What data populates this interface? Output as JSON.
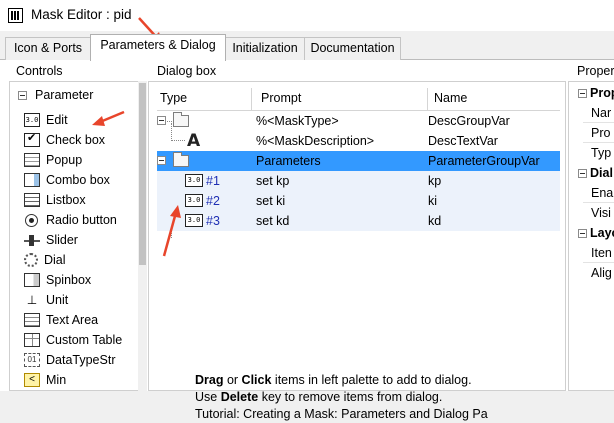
{
  "window": {
    "title": "Mask Editor : pid"
  },
  "tabs": [
    {
      "label": "Icon & Ports"
    },
    {
      "label": "Parameters & Dialog"
    },
    {
      "label": "Initialization"
    },
    {
      "label": "Documentation"
    }
  ],
  "controls": {
    "title": "Controls",
    "group_label": "Parameter",
    "items": [
      {
        "label": "Edit",
        "icon": "edit-icon",
        "glyph": "3.0"
      },
      {
        "label": "Check box",
        "icon": "checkbox-icon"
      },
      {
        "label": "Popup",
        "icon": "popup-icon"
      },
      {
        "label": "Combo box",
        "icon": "combo-box-icon"
      },
      {
        "label": "Listbox",
        "icon": "listbox-icon"
      },
      {
        "label": "Radio button",
        "icon": "radio-button-icon"
      },
      {
        "label": "Slider",
        "icon": "slider-icon"
      },
      {
        "label": "Dial",
        "icon": "dial-icon"
      },
      {
        "label": "Spinbox",
        "icon": "spinbox-icon"
      },
      {
        "label": "Unit",
        "icon": "unit-icon",
        "glyph": "⊥"
      },
      {
        "label": "Text Area",
        "icon": "text-area-icon"
      },
      {
        "label": "Custom Table",
        "icon": "custom-table-icon"
      },
      {
        "label": "DataTypeStr",
        "icon": "datatypestr-icon",
        "glyph": "01"
      },
      {
        "label": "Min",
        "icon": "min-icon",
        "glyph": "<"
      }
    ]
  },
  "dialog": {
    "title": "Dialog box",
    "columns": {
      "type": "Type",
      "prompt": "Prompt",
      "name": "Name"
    },
    "rows": [
      {
        "id": "",
        "prompt": "%<MaskType>",
        "name": "DescGroupVar"
      },
      {
        "id": "",
        "prompt": "%<MaskDescription>",
        "name": "DescTextVar",
        "type_glyph": "A"
      },
      {
        "id": "",
        "prompt": "Parameters",
        "name": "ParameterGroupVar"
      },
      {
        "id": "#1",
        "prompt": "set kp",
        "name": "kp",
        "type_glyph": "3.0"
      },
      {
        "id": "#2",
        "prompt": "set ki",
        "name": "ki",
        "type_glyph": "3.0"
      },
      {
        "id": "#3",
        "prompt": "set kd",
        "name": "kd",
        "type_glyph": "3.0"
      }
    ],
    "instructions": {
      "line1": {
        "bold": "Drag",
        "t1": " or ",
        "bold2": "Click",
        "t2": " items in left palette to add to dialog."
      },
      "line2": {
        "t1": "Use ",
        "bold": "Delete",
        "t2": " key to remove items from dialog."
      },
      "line3": {
        "t1": "Tutorial: Creating a Mask: Parameters and Dialog Pa"
      }
    }
  },
  "properties": {
    "title": "Proper",
    "categories": [
      {
        "label": "Prop",
        "items": [
          "Nar",
          "Pro",
          "Typ"
        ]
      },
      {
        "label": "Dial",
        "items": [
          "Ena",
          "Visi"
        ]
      },
      {
        "label": "Layo",
        "items": [
          "Iten",
          "Alig"
        ]
      }
    ]
  },
  "colors": {
    "selection": "#3399ff",
    "arrows": "#e8452b",
    "link_text": "#1f2fb3"
  }
}
